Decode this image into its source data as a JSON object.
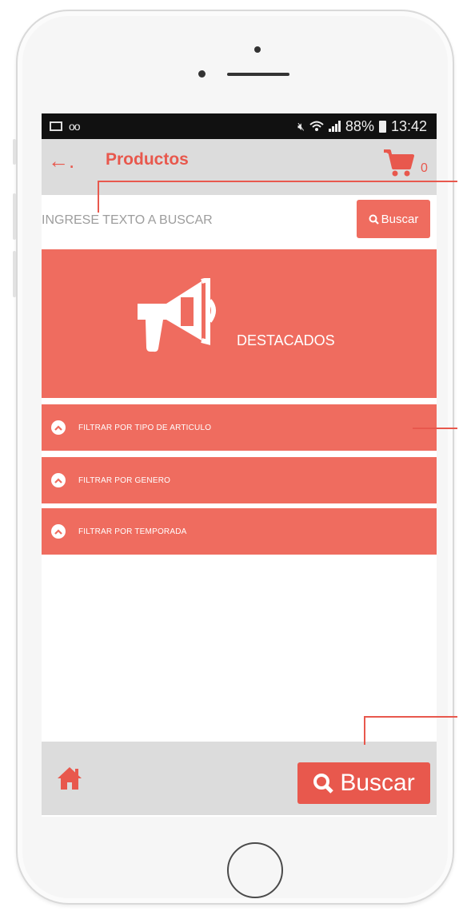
{
  "status_bar": {
    "battery": "88%",
    "time": "13:42",
    "left_icons": [
      "image-icon",
      "voicemail-icon"
    ],
    "right_icons": [
      "mute-icon",
      "wifi-icon",
      "signal-icon",
      "battery-icon"
    ]
  },
  "app_bar": {
    "back_glyph": "←.",
    "title": "Productos",
    "cart_count": "0"
  },
  "search": {
    "placeholder": "INGRESE TEXTO A BUSCAR",
    "button_label": "Buscar"
  },
  "featured": {
    "label": "DESTACADOS"
  },
  "filters": [
    {
      "label": "FILTRAR POR TIPO DE ARTICULO"
    },
    {
      "label": "FILTRAR POR GENERO"
    },
    {
      "label": "FILTRAR POR TEMPORADA"
    }
  ],
  "bottom_bar": {
    "search_label": "Buscar"
  },
  "colors": {
    "accent": "#ef6c5f",
    "accent_dark": "#e8584d",
    "bar_gray": "#dcdcdc"
  }
}
